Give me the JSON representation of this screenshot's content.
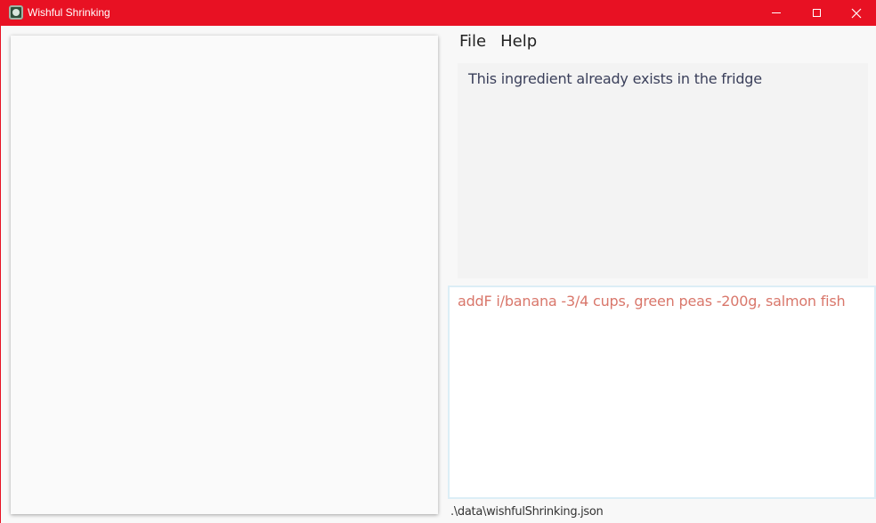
{
  "window": {
    "title": "Wishful Shrinking",
    "title_bar_color": "#e81123",
    "icon": "app-logo-icon"
  },
  "menu": {
    "items": [
      {
        "label": "File"
      },
      {
        "label": "Help"
      }
    ]
  },
  "result_display": {
    "text": "This ingredient already exists in the fridge"
  },
  "command_box": {
    "value": "addF i/banana -3/4 cups, green peas -200g, salmon fish",
    "text_color": "#d9776b"
  },
  "status_bar": {
    "file_path": ".\\data\\wishfulShrinking.json"
  },
  "icons": {
    "minimize": "minimize-icon",
    "maximize": "maximize-icon",
    "close": "close-icon"
  }
}
